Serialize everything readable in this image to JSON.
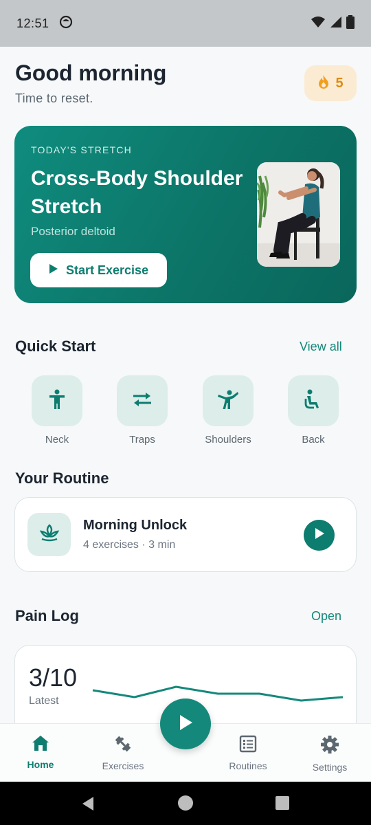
{
  "status_bar": {
    "time": "12:51"
  },
  "header": {
    "greeting": "Good morning",
    "subtitle": "Time to reset.",
    "streak_count": "5"
  },
  "hero": {
    "eyebrow": "TODAY'S STRETCH",
    "title": "Cross-Body Shoulder Stretch",
    "subtitle": "Posterior deltoid",
    "button_label": "Start Exercise"
  },
  "quick_start": {
    "title": "Quick Start",
    "link": "View all",
    "items": [
      {
        "label": "Neck",
        "icon": "person-standing-icon"
      },
      {
        "label": "Traps",
        "icon": "swap-arrows-icon"
      },
      {
        "label": "Shoulders",
        "icon": "person-stretch-icon"
      },
      {
        "label": "Back",
        "icon": "seated-person-icon"
      }
    ]
  },
  "routine": {
    "title": "Your Routine",
    "name": "Morning Unlock",
    "meta": "4 exercises · 3 min"
  },
  "pain_log": {
    "title": "Pain Log",
    "link": "Open",
    "value": "3/10",
    "caption": "Latest",
    "trend": [
      3.2,
      3.0,
      3.3,
      3.1,
      3.1,
      2.9,
      3.0
    ]
  },
  "nav": {
    "home": "Home",
    "exercises": "Exercises",
    "routines": "Routines",
    "settings": "Settings"
  },
  "colors": {
    "accent": "#0d7d70",
    "streak": "#e08a11",
    "tile_bg": "#dcedea"
  }
}
